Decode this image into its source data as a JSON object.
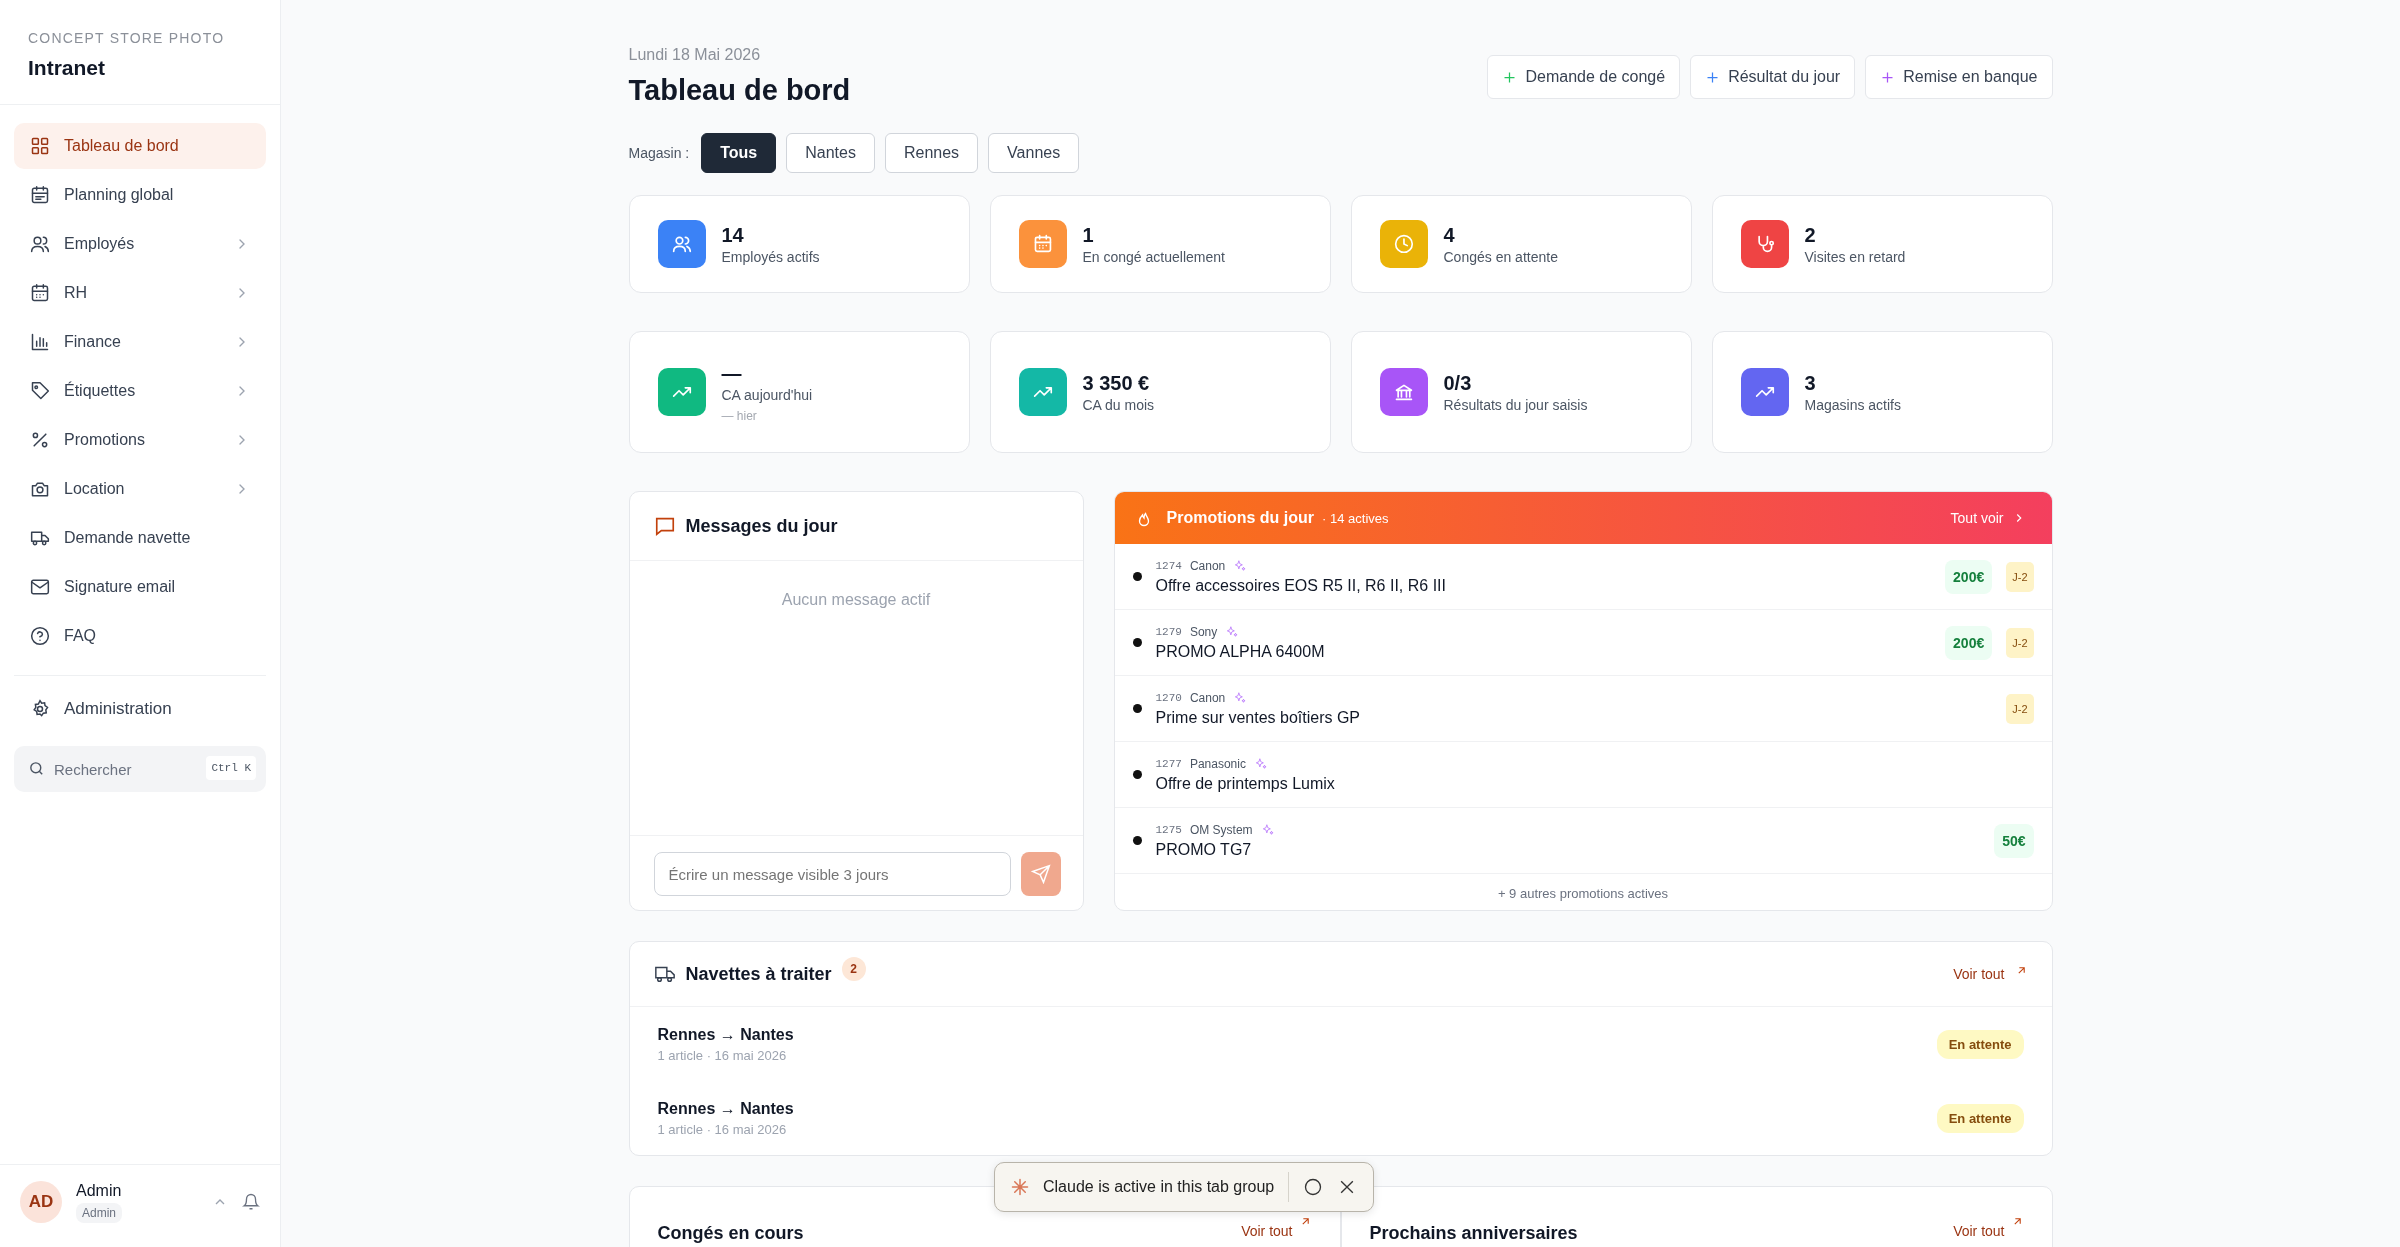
{
  "sidebar": {
    "brand_subtitle": "CONCEPT STORE PHOTO",
    "brand_title": "Intranet",
    "items": [
      {
        "label": "Tableau de bord",
        "selected": true,
        "has_submenu": false
      },
      {
        "label": "Planning global",
        "selected": false,
        "has_submenu": false
      },
      {
        "label": "Employés",
        "selected": false,
        "has_submenu": true
      },
      {
        "label": "RH",
        "selected": false,
        "has_submenu": true
      },
      {
        "label": "Finance",
        "selected": false,
        "has_submenu": true
      },
      {
        "label": "Étiquettes",
        "selected": false,
        "has_submenu": true
      },
      {
        "label": "Promotions",
        "selected": false,
        "has_submenu": true
      },
      {
        "label": "Location",
        "selected": false,
        "has_submenu": true
      },
      {
        "label": "Demande navette",
        "selected": false,
        "has_submenu": false
      },
      {
        "label": "Signature email",
        "selected": false,
        "has_submenu": false
      },
      {
        "label": "FAQ",
        "selected": false,
        "has_submenu": false
      }
    ],
    "admin_item": {
      "label": "Administration"
    },
    "search": {
      "placeholder": "Rechercher",
      "shortcut": "Ctrl K"
    },
    "user": {
      "initials": "AD",
      "name": "Admin",
      "role": "Admin"
    }
  },
  "header": {
    "date": "Lundi 18 Mai 2026",
    "title": "Tableau de bord",
    "actions": [
      {
        "label": "Demande de congé",
        "color": "#22c55e"
      },
      {
        "label": "Résultat du jour",
        "color": "#3b82f6"
      },
      {
        "label": "Remise en banque",
        "color": "#a855f7"
      }
    ]
  },
  "store_filter": {
    "label": "Magasin :",
    "options": [
      {
        "label": "Tous",
        "selected": true
      },
      {
        "label": "Nantes",
        "selected": false
      },
      {
        "label": "Rennes",
        "selected": false
      },
      {
        "label": "Vannes",
        "selected": false
      }
    ]
  },
  "stats": [
    {
      "value": "14",
      "label": "Employés actifs",
      "color": "#3b82f6"
    },
    {
      "value": "1",
      "label": "En congé actuellement",
      "color": "#fb923c"
    },
    {
      "value": "4",
      "label": "Congés en attente",
      "color": "#eab308"
    },
    {
      "value": "2",
      "label": "Visites en retard",
      "color": "#ef4444"
    }
  ],
  "stats_2": [
    {
      "value": "—",
      "label": "CA aujourd'hui",
      "sub": "— hier",
      "color": "#10b981"
    },
    {
      "value": "3 350 €",
      "label": "CA du mois",
      "color": "#14b8a6"
    },
    {
      "value": "0/3",
      "label": "Résultats du jour saisis",
      "color": "#a855f7"
    },
    {
      "value": "3",
      "label": "Magasins actifs",
      "color": "#6366f1"
    }
  ],
  "messages": {
    "title": "Messages du jour",
    "empty": "Aucun message actif",
    "input_placeholder": "Écrire un message visible 3 jours"
  },
  "promotions": {
    "title": "Promotions du jour",
    "count": "· 14 actives",
    "link": "Tout voir",
    "rows": [
      {
        "number": "1274",
        "brand": "Canon",
        "title": "Offre accessoires EOS R5 II, R6 II, R6 III",
        "amount": "200€",
        "deadline": "J-2"
      },
      {
        "number": "1279",
        "brand": "Sony",
        "title": "PROMO ALPHA 6400M",
        "amount": "200€",
        "deadline": "J-2"
      },
      {
        "number": "1270",
        "brand": "Canon",
        "title": "Prime sur ventes boîtiers GP",
        "deadline": "J-2"
      },
      {
        "number": "1277",
        "brand": "Panasonic",
        "title": "Offre de printemps Lumix"
      },
      {
        "number": "1275",
        "brand": "OM System",
        "title": "PROMO TG7",
        "amount": "50€"
      }
    ],
    "more": "+ 9 autres promotions actives"
  },
  "shuttles": {
    "title": "Navettes à traiter",
    "count": "2",
    "link": "Voir tout",
    "rows": [
      {
        "route": "Rennes → Nantes",
        "meta": "1 article · 16 mai 2026",
        "status": "En attente"
      },
      {
        "route": "Rennes → Nantes",
        "meta": "1 article · 16 mai 2026",
        "status": "En attente"
      }
    ]
  },
  "bottom_cards": [
    {
      "title": "Congés en cours",
      "link": "Voir tout"
    },
    {
      "title": "Prochains anniversaires",
      "link": "Voir tout"
    }
  ],
  "toast": {
    "text": "Claude is active in this tab group"
  }
}
